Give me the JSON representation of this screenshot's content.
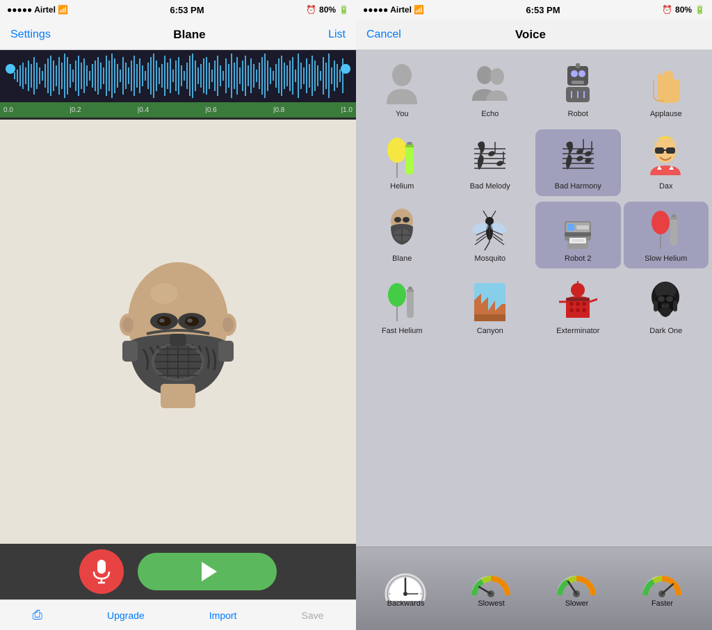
{
  "left": {
    "statusBar": {
      "carrier": "Airtel",
      "time": "6:53 PM",
      "battery": "80%"
    },
    "navBar": {
      "settings": "Settings",
      "title": "Blane",
      "list": "List"
    },
    "timeline": {
      "markers": [
        "0.0",
        "|0.2",
        "|0.4",
        "|0.6",
        "|0.8",
        "|1.0"
      ]
    },
    "bottomToolbar": {
      "upgrade": "Upgrade",
      "import": "Import",
      "save": "Save"
    }
  },
  "right": {
    "statusBar": {
      "carrier": "Airtel",
      "time": "6:53 PM",
      "battery": "80%"
    },
    "navBar": {
      "cancel": "Cancel",
      "title": "Voice"
    },
    "voices": [
      {
        "id": "you",
        "label": "You",
        "emoji": "🧍",
        "selected": false
      },
      {
        "id": "echo",
        "label": "Echo",
        "emoji": "👥",
        "selected": false
      },
      {
        "id": "robot",
        "label": "Robot",
        "emoji": "🤖",
        "selected": false
      },
      {
        "id": "applause",
        "label": "Applause",
        "emoji": "👏",
        "selected": false
      },
      {
        "id": "helium",
        "label": "Helium",
        "emoji": "🎈",
        "selected": false
      },
      {
        "id": "bad-melody",
        "label": "Bad Melody",
        "emoji": "🎵",
        "selected": false
      },
      {
        "id": "bad-harmony",
        "label": "Bad Harmony",
        "emoji": "🎶",
        "selected": true
      },
      {
        "id": "dax",
        "label": "Dax",
        "emoji": "😎",
        "selected": false
      },
      {
        "id": "blane",
        "label": "Blane",
        "emoji": "😈",
        "selected": false
      },
      {
        "id": "mosquito",
        "label": "Mosquito",
        "emoji": "🦟",
        "selected": false
      },
      {
        "id": "robot2",
        "label": "Robot 2",
        "emoji": "🖨️",
        "selected": true
      },
      {
        "id": "slow-helium",
        "label": "Slow Helium",
        "emoji": "🎈",
        "selected": true
      },
      {
        "id": "fast-helium",
        "label": "Fast Helium",
        "emoji": "🟢",
        "selected": false
      },
      {
        "id": "canyon",
        "label": "Canyon",
        "emoji": "🏔️",
        "selected": false
      },
      {
        "id": "exterminator",
        "label": "Exterminator",
        "emoji": "🔴",
        "selected": false
      },
      {
        "id": "dark-one",
        "label": "Dark One",
        "emoji": "🌑",
        "selected": false
      }
    ],
    "speeds": [
      {
        "id": "backwards",
        "label": "Backwards"
      },
      {
        "id": "slowest",
        "label": "Slowest"
      },
      {
        "id": "slower",
        "label": "Slower"
      },
      {
        "id": "faster",
        "label": "Faster"
      }
    ]
  }
}
